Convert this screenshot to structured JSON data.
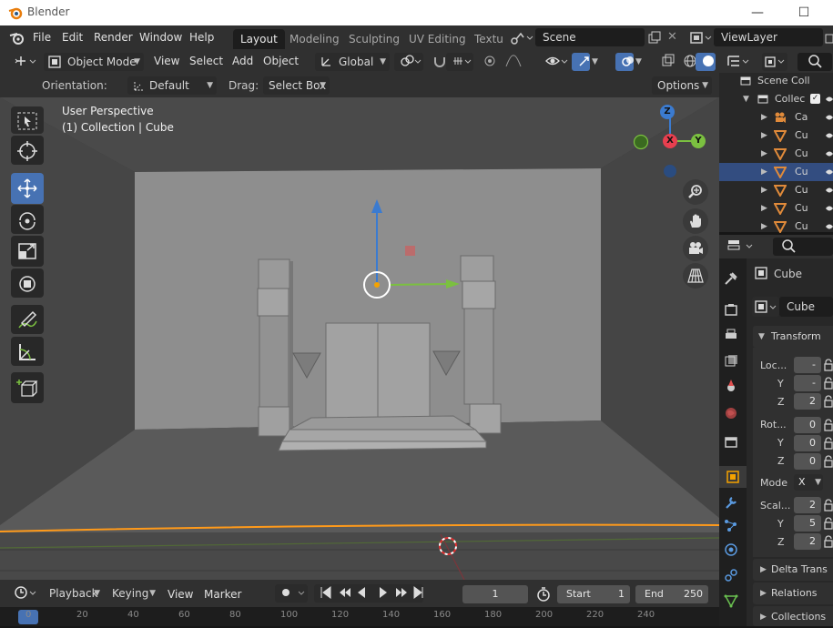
{
  "window": {
    "title": "Blender"
  },
  "menu": {
    "file": "File",
    "edit": "Edit",
    "render": "Render",
    "window": "Window",
    "help": "Help"
  },
  "workspaces": [
    "Layout",
    "Modeling",
    "Sculpting",
    "UV Editing",
    "Textu"
  ],
  "scene": {
    "label": "Scene"
  },
  "viewlayer": {
    "label": "ViewLayer"
  },
  "header": {
    "mode": "Object Mode",
    "view": "View",
    "select": "Select",
    "add": "Add",
    "object": "Object",
    "transform_orientation": "Global"
  },
  "tool_settings": {
    "orientation_label": "Orientation:",
    "orientation_value": "Default",
    "drag_label": "Drag:",
    "drag_value": "Select Box",
    "options": "Options"
  },
  "viewport": {
    "perspective": "User Perspective",
    "context": "(1) Collection | Cube",
    "gizmo_axes": {
      "z": "Z",
      "x": "X",
      "y": "Y"
    }
  },
  "timeline": {
    "playback": "Playback",
    "keying": "Keying",
    "view": "View",
    "marker": "Marker",
    "current_frame": "1",
    "start_label": "Start",
    "start_value": "1",
    "end_label": "End",
    "end_value": "250"
  },
  "ruler": {
    "ticks": [
      "0",
      "20",
      "40",
      "60",
      "80",
      "100",
      "120",
      "140",
      "160",
      "180",
      "200",
      "220",
      "240"
    ]
  },
  "outliner": {
    "scene_collection": "Scene Coll",
    "collection": "Collec",
    "items": [
      "Ca",
      "Cu",
      "Cu",
      "Cu",
      "Cu",
      "Cu",
      "Cu"
    ]
  },
  "properties": {
    "object_name": "Cube",
    "data_name": "Cube",
    "transform_panel": "Transform",
    "location": {
      "label": "Loc...",
      "x": "-",
      "y": "-",
      "z": "2",
      "y_label": "Y",
      "z_label": "Z"
    },
    "rotation": {
      "label": "Rot...",
      "x": "0",
      "y": "0",
      "z": "0",
      "y_label": "Y",
      "z_label": "Z"
    },
    "mode": {
      "label": "Mode",
      "value": "X"
    },
    "scale": {
      "label": "Scal...",
      "x": "2",
      "y": "5",
      "z": "2",
      "y_label": "Y",
      "z_label": "Z"
    },
    "delta_panel": "Delta Trans",
    "relations_panel": "Relations",
    "collections_panel": "Collections"
  },
  "colors": {
    "accent": "#4772b3",
    "selected_row": "#334d80",
    "x_axis": "#e83f4f",
    "y_axis": "#7bc040",
    "z_axis": "#3b7bd0",
    "origin": "#f5a200"
  }
}
